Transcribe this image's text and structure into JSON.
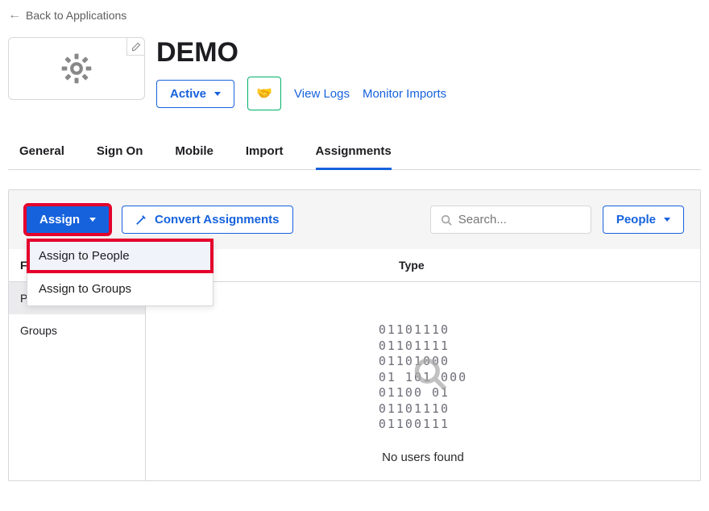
{
  "nav": {
    "back_label": "Back to Applications"
  },
  "app": {
    "title": "DEMO",
    "status_label": "Active"
  },
  "links": {
    "view_logs": "View Logs",
    "monitor_imports": "Monitor Imports"
  },
  "tabs": [
    "General",
    "Sign On",
    "Mobile",
    "Import",
    "Assignments"
  ],
  "active_tab_index": 4,
  "toolbar": {
    "assign_label": "Assign",
    "convert_label": "Convert Assignments",
    "search_placeholder": "Search...",
    "filter_type_label": "People"
  },
  "assign_menu": {
    "items": [
      "Assign to People",
      "Assign to Groups"
    ],
    "highlighted_index": 0
  },
  "sidebar": {
    "header": "Filters",
    "header_truncated": "Fi",
    "items": [
      "People",
      "Groups"
    ],
    "selected_index": 0,
    "people_truncated": "Pe"
  },
  "table": {
    "type_header": "Type"
  },
  "empty": {
    "lines": [
      "01101110",
      "01101111",
      "01101110",
      "01101000",
      "01100001",
      "01101110",
      "01100111"
    ],
    "lines_display": [
      "01101110",
      "01101111",
      "01101000",
      "01 101 000",
      "01100  01",
      "01101110",
      "01100111"
    ],
    "message": "No users found"
  }
}
